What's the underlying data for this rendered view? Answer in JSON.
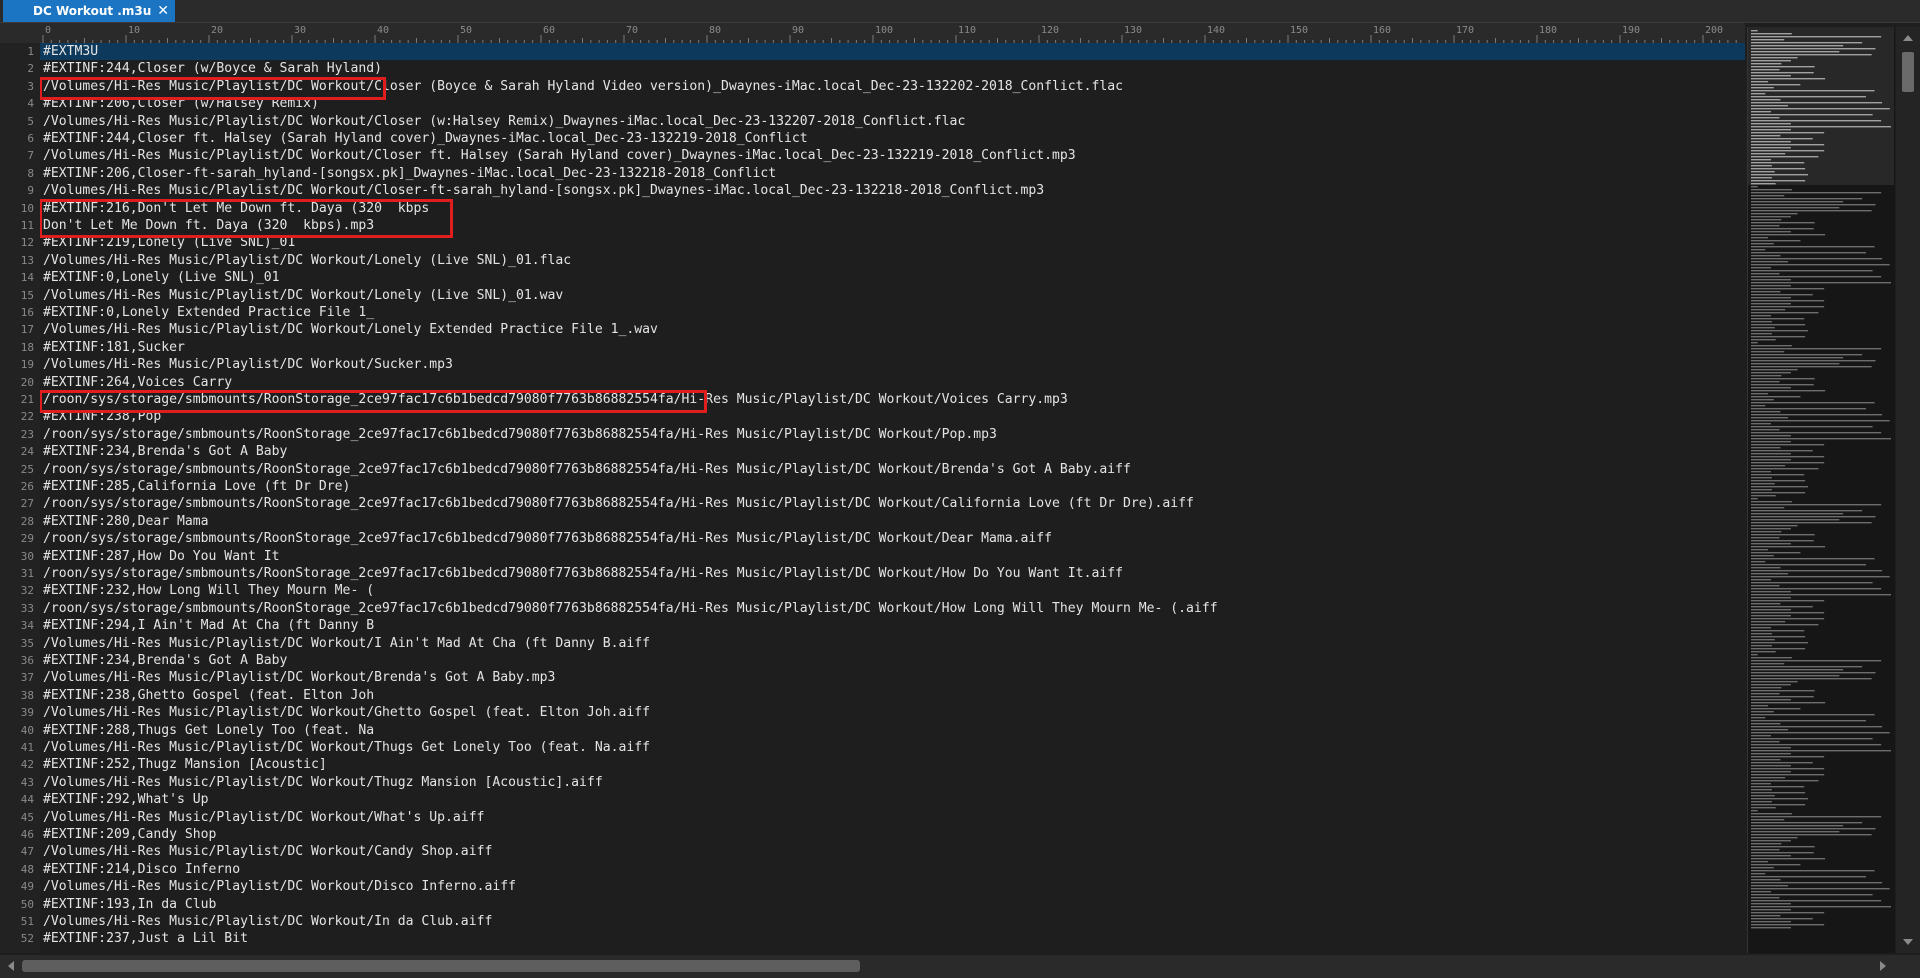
{
  "tab": {
    "title": "DC Workout .m3u",
    "close_glyph": "✕"
  },
  "ruler": {
    "labels": [
      "0",
      "10",
      "20",
      "30",
      "40",
      "50",
      "60",
      "70",
      "80",
      "90",
      "100",
      "110",
      "120",
      "130",
      "140",
      "150",
      "160",
      "170",
      "180",
      "190",
      "200"
    ]
  },
  "editor": {
    "current_line": 1,
    "lines": [
      "#EXTM3U",
      "#EXTINF:244,Closer (w/Boyce & Sarah Hyland)",
      "/Volumes/Hi-Res Music/Playlist/DC Workout/Closer (Boyce & Sarah Hyland Video version)_Dwaynes-iMac.local_Dec-23-132202-2018_Conflict.flac",
      "#EXTINF:206,Closer (w/Halsey Remix)",
      "/Volumes/Hi-Res Music/Playlist/DC Workout/Closer (w:Halsey Remix)_Dwaynes-iMac.local_Dec-23-132207-2018_Conflict.flac",
      "#EXTINF:244,Closer ft. Halsey (Sarah Hyland cover)_Dwaynes-iMac.local_Dec-23-132219-2018_Conflict",
      "/Volumes/Hi-Res Music/Playlist/DC Workout/Closer ft. Halsey (Sarah Hyland cover)_Dwaynes-iMac.local_Dec-23-132219-2018_Conflict.mp3",
      "#EXTINF:206,Closer-ft-sarah_hyland-[songsx.pk]_Dwaynes-iMac.local_Dec-23-132218-2018_Conflict",
      "/Volumes/Hi-Res Music/Playlist/DC Workout/Closer-ft-sarah_hyland-[songsx.pk]_Dwaynes-iMac.local_Dec-23-132218-2018_Conflict.mp3",
      "#EXTINF:216,Don't Let Me Down ft. Daya (320  kbps",
      "Don't Let Me Down ft. Daya (320  kbps).mp3",
      "#EXTINF:219,Lonely (Live SNL)_01",
      "/Volumes/Hi-Res Music/Playlist/DC Workout/Lonely (Live SNL)_01.flac",
      "#EXTINF:0,Lonely (Live SNL)_01",
      "/Volumes/Hi-Res Music/Playlist/DC Workout/Lonely (Live SNL)_01.wav",
      "#EXTINF:0,Lonely Extended Practice File 1_",
      "/Volumes/Hi-Res Music/Playlist/DC Workout/Lonely Extended Practice File 1_.wav",
      "#EXTINF:181,Sucker",
      "/Volumes/Hi-Res Music/Playlist/DC Workout/Sucker.mp3",
      "#EXTINF:264,Voices Carry",
      "/roon/sys/storage/smbmounts/RoonStorage_2ce97fac17c6b1bedcd79080f7763b86882554fa/Hi-Res Music/Playlist/DC Workout/Voices Carry.mp3",
      "#EXTINF:238,Pop",
      "/roon/sys/storage/smbmounts/RoonStorage_2ce97fac17c6b1bedcd79080f7763b86882554fa/Hi-Res Music/Playlist/DC Workout/Pop.mp3",
      "#EXTINF:234,Brenda's Got A Baby",
      "/roon/sys/storage/smbmounts/RoonStorage_2ce97fac17c6b1bedcd79080f7763b86882554fa/Hi-Res Music/Playlist/DC Workout/Brenda's Got A Baby.aiff",
      "#EXTINF:285,California Love (ft Dr Dre)",
      "/roon/sys/storage/smbmounts/RoonStorage_2ce97fac17c6b1bedcd79080f7763b86882554fa/Hi-Res Music/Playlist/DC Workout/California Love (ft Dr Dre).aiff",
      "#EXTINF:280,Dear Mama",
      "/roon/sys/storage/smbmounts/RoonStorage_2ce97fac17c6b1bedcd79080f7763b86882554fa/Hi-Res Music/Playlist/DC Workout/Dear Mama.aiff",
      "#EXTINF:287,How Do You Want It",
      "/roon/sys/storage/smbmounts/RoonStorage_2ce97fac17c6b1bedcd79080f7763b86882554fa/Hi-Res Music/Playlist/DC Workout/How Do You Want It.aiff",
      "#EXTINF:232,How Long Will They Mourn Me- (",
      "/roon/sys/storage/smbmounts/RoonStorage_2ce97fac17c6b1bedcd79080f7763b86882554fa/Hi-Res Music/Playlist/DC Workout/How Long Will They Mourn Me- (.aiff",
      "#EXTINF:294,I Ain't Mad At Cha (ft Danny B",
      "/Volumes/Hi-Res Music/Playlist/DC Workout/I Ain't Mad At Cha (ft Danny B.aiff",
      "#EXTINF:234,Brenda's Got A Baby",
      "/Volumes/Hi-Res Music/Playlist/DC Workout/Brenda's Got A Baby.mp3",
      "#EXTINF:238,Ghetto Gospel (feat. Elton Joh",
      "/Volumes/Hi-Res Music/Playlist/DC Workout/Ghetto Gospel (feat. Elton Joh.aiff",
      "#EXTINF:288,Thugs Get Lonely Too (feat. Na",
      "/Volumes/Hi-Res Music/Playlist/DC Workout/Thugs Get Lonely Too (feat. Na.aiff",
      "#EXTINF:252,Thugz Mansion [Acoustic]",
      "/Volumes/Hi-Res Music/Playlist/DC Workout/Thugz Mansion [Acoustic].aiff",
      "#EXTINF:292,What's Up",
      "/Volumes/Hi-Res Music/Playlist/DC Workout/What's Up.aiff",
      "#EXTINF:209,Candy Shop",
      "/Volumes/Hi-Res Music/Playlist/DC Workout/Candy Shop.aiff",
      "#EXTINF:214,Disco Inferno",
      "/Volumes/Hi-Res Music/Playlist/DC Workout/Disco Inferno.aiff",
      "#EXTINF:193,In da Club",
      "/Volumes/Hi-Res Music/Playlist/DC Workout/In da Club.aiff",
      "#EXTINF:237,Just a Lil Bit"
    ]
  },
  "colors": {
    "tab_active": "#1b75c2",
    "current_line": "#0d3a5c",
    "highlight_box": "#e01e1e",
    "text": "#e4e4e4",
    "line_number": "#8a8a8a"
  },
  "icons": {
    "tab_close": "close-icon",
    "scroll_up": "arrow-up-icon",
    "scroll_down": "arrow-down-icon",
    "scroll_left": "arrow-left-icon",
    "scroll_right": "arrow-right-icon"
  }
}
